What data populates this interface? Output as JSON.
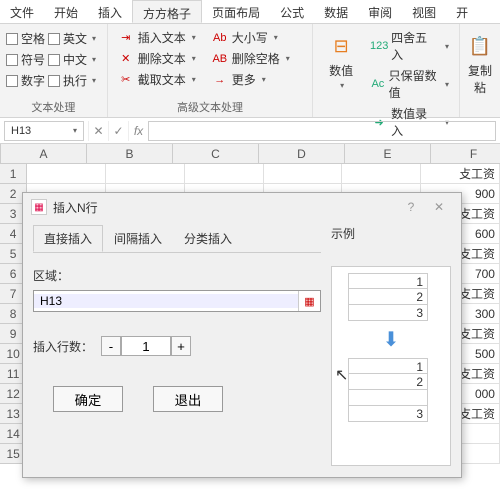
{
  "tabs": [
    "文件",
    "开始",
    "插入",
    "方方格子",
    "页面布局",
    "公式",
    "数据",
    "审阅",
    "视图",
    "开"
  ],
  "activeTab": 3,
  "groupA": {
    "checks": [
      [
        "空格",
        "英文"
      ],
      [
        "符号",
        "中文"
      ],
      [
        "数字",
        "执行"
      ]
    ],
    "label": "文本处理"
  },
  "groupB": {
    "items": [
      "插入文本",
      "删除文本",
      "截取文本"
    ],
    "items2": [
      "大小写",
      "删除空格",
      "更多"
    ],
    "prefix": [
      "Ab",
      "AB",
      "→"
    ],
    "label": "高级文本处理"
  },
  "groupC": {
    "big": "数值",
    "items": [
      "四舍五入",
      "只保留数值",
      "数值录入"
    ],
    "prefix": [
      "123",
      "Ac",
      "➜"
    ],
    "label": "数值录入"
  },
  "groupD": {
    "big": "复制\n粘"
  },
  "nameBox": "H13",
  "columns": [
    "A",
    "B",
    "C",
    "D",
    "E",
    "F"
  ],
  "rows": [
    1,
    2,
    3,
    4,
    5,
    6,
    7,
    8,
    9,
    10,
    11,
    12,
    13,
    14,
    15
  ],
  "fcol": [
    "攴工资",
    "900",
    "攴工资",
    "600",
    "攴工资",
    "700",
    "攴工资",
    "300",
    "攴工资",
    "500",
    "攴工资",
    "000",
    "攴工资",
    "",
    ""
  ],
  "dialog": {
    "title": "插入N行",
    "tabs": [
      "直接插入",
      "间隔插入",
      "分类插入"
    ],
    "activeTab": 0,
    "rangeLabel": "区域：",
    "rangeValue": "H13",
    "rowsLabel": "插入行数：",
    "rowsValue": "1",
    "ok": "确定",
    "cancel": "退出",
    "previewLabel": "示例",
    "previewTop": [
      "1",
      "2",
      "3"
    ],
    "previewBottom": [
      "1",
      "2",
      "",
      "3"
    ]
  }
}
